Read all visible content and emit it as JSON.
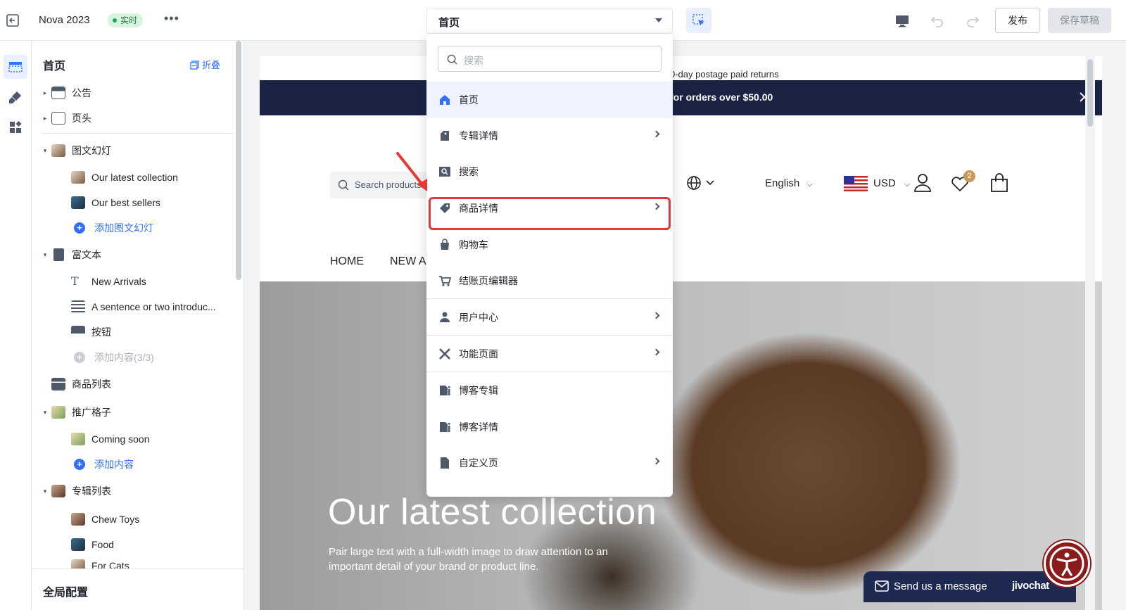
{
  "topbar": {
    "title": "Nova 2023",
    "badge": "实时",
    "more": "•••",
    "page_select": "首页",
    "publish": "发布",
    "save_draft": "保存草稿"
  },
  "sidebar": {
    "heading": "首页",
    "collapse": "折叠",
    "footer": "全局配置",
    "items": [
      {
        "label": "公告",
        "level": 0,
        "caret": "▸",
        "thumb": "announce"
      },
      {
        "label": "页头",
        "level": 0,
        "caret": "▸",
        "thumb": "header"
      },
      {
        "label": "图文幻灯",
        "level": 0,
        "caret": "▾",
        "thumb": "photo"
      },
      {
        "label": "Our latest collection",
        "level": 1,
        "thumb": "photo"
      },
      {
        "label": "Our best sellers",
        "level": 1,
        "thumb": "photo2"
      },
      {
        "label": "添加图文幻灯",
        "level": 1,
        "type": "add"
      },
      {
        "label": "富文本",
        "level": 0,
        "caret": "▾",
        "thumb": "doc"
      },
      {
        "label": "New Arrivals",
        "level": 1,
        "thumb": "text"
      },
      {
        "label": "A sentence or two introduc...",
        "level": 1,
        "thumb": "lines"
      },
      {
        "label": "按钮",
        "level": 1,
        "thumb": "button"
      },
      {
        "label": "添加内容(3/3)",
        "level": 1,
        "type": "add-disabled"
      },
      {
        "label": "商品列表",
        "level": 0,
        "thumb": "list"
      },
      {
        "label": "推广格子",
        "level": 0,
        "caret": "▾",
        "thumb": "photo3"
      },
      {
        "label": "Coming soon",
        "level": 1,
        "thumb": "photo3"
      },
      {
        "label": "添加内容",
        "level": 1,
        "type": "add"
      },
      {
        "label": "专辑列表",
        "level": 0,
        "caret": "▾",
        "thumb": "photo4"
      },
      {
        "label": "Chew Toys",
        "level": 1,
        "thumb": "photo4"
      },
      {
        "label": "Food",
        "level": 1,
        "thumb": "photo2"
      },
      {
        "label": "For Cats",
        "level": 1,
        "thumb": "photo"
      }
    ]
  },
  "dropdown": {
    "search_placeholder": "搜索",
    "items": [
      {
        "label": "首页",
        "icon": "home-icon",
        "submenu": false,
        "selected": true
      },
      {
        "label": "专辑详情",
        "icon": "tags-icon",
        "submenu": true
      },
      {
        "label": "搜索",
        "icon": "search-page-icon",
        "submenu": false
      },
      {
        "label": "商品详情",
        "icon": "tag-icon",
        "submenu": true,
        "highlighted": true
      },
      {
        "label": "购物车",
        "icon": "bag-icon",
        "submenu": false
      },
      {
        "label": "结账页编辑器",
        "icon": "cart-icon",
        "submenu": false
      },
      {
        "label": "用户中心",
        "icon": "user-icon",
        "submenu": true
      },
      {
        "label": "功能页面",
        "icon": "tools-icon",
        "submenu": true
      },
      {
        "label": "博客专辑",
        "icon": "blog-icon",
        "submenu": false
      },
      {
        "label": "博客详情",
        "icon": "blog-icon",
        "submenu": false
      },
      {
        "label": "自定义页",
        "icon": "file-icon",
        "submenu": true
      }
    ]
  },
  "preview": {
    "announcement": "0-day postage paid returns",
    "promo": "for orders over $50.00",
    "search_placeholder": "Search products",
    "language": "English",
    "currency": "USD",
    "wishlist_count": "2",
    "nav_home": "HOME",
    "nav_new": "NEW A",
    "hero_title": "Our latest collection",
    "hero_subtitle": "Pair large text with a full-width image to draw attention to an important detail of your brand or product line.",
    "chat_message": "Send us a message",
    "chat_brand": "jivochat"
  },
  "colors": {
    "accent": "#3370ff",
    "promo_bg": "#1b2345",
    "highlight": "#e53935",
    "live_badge": "#d7f4df"
  }
}
